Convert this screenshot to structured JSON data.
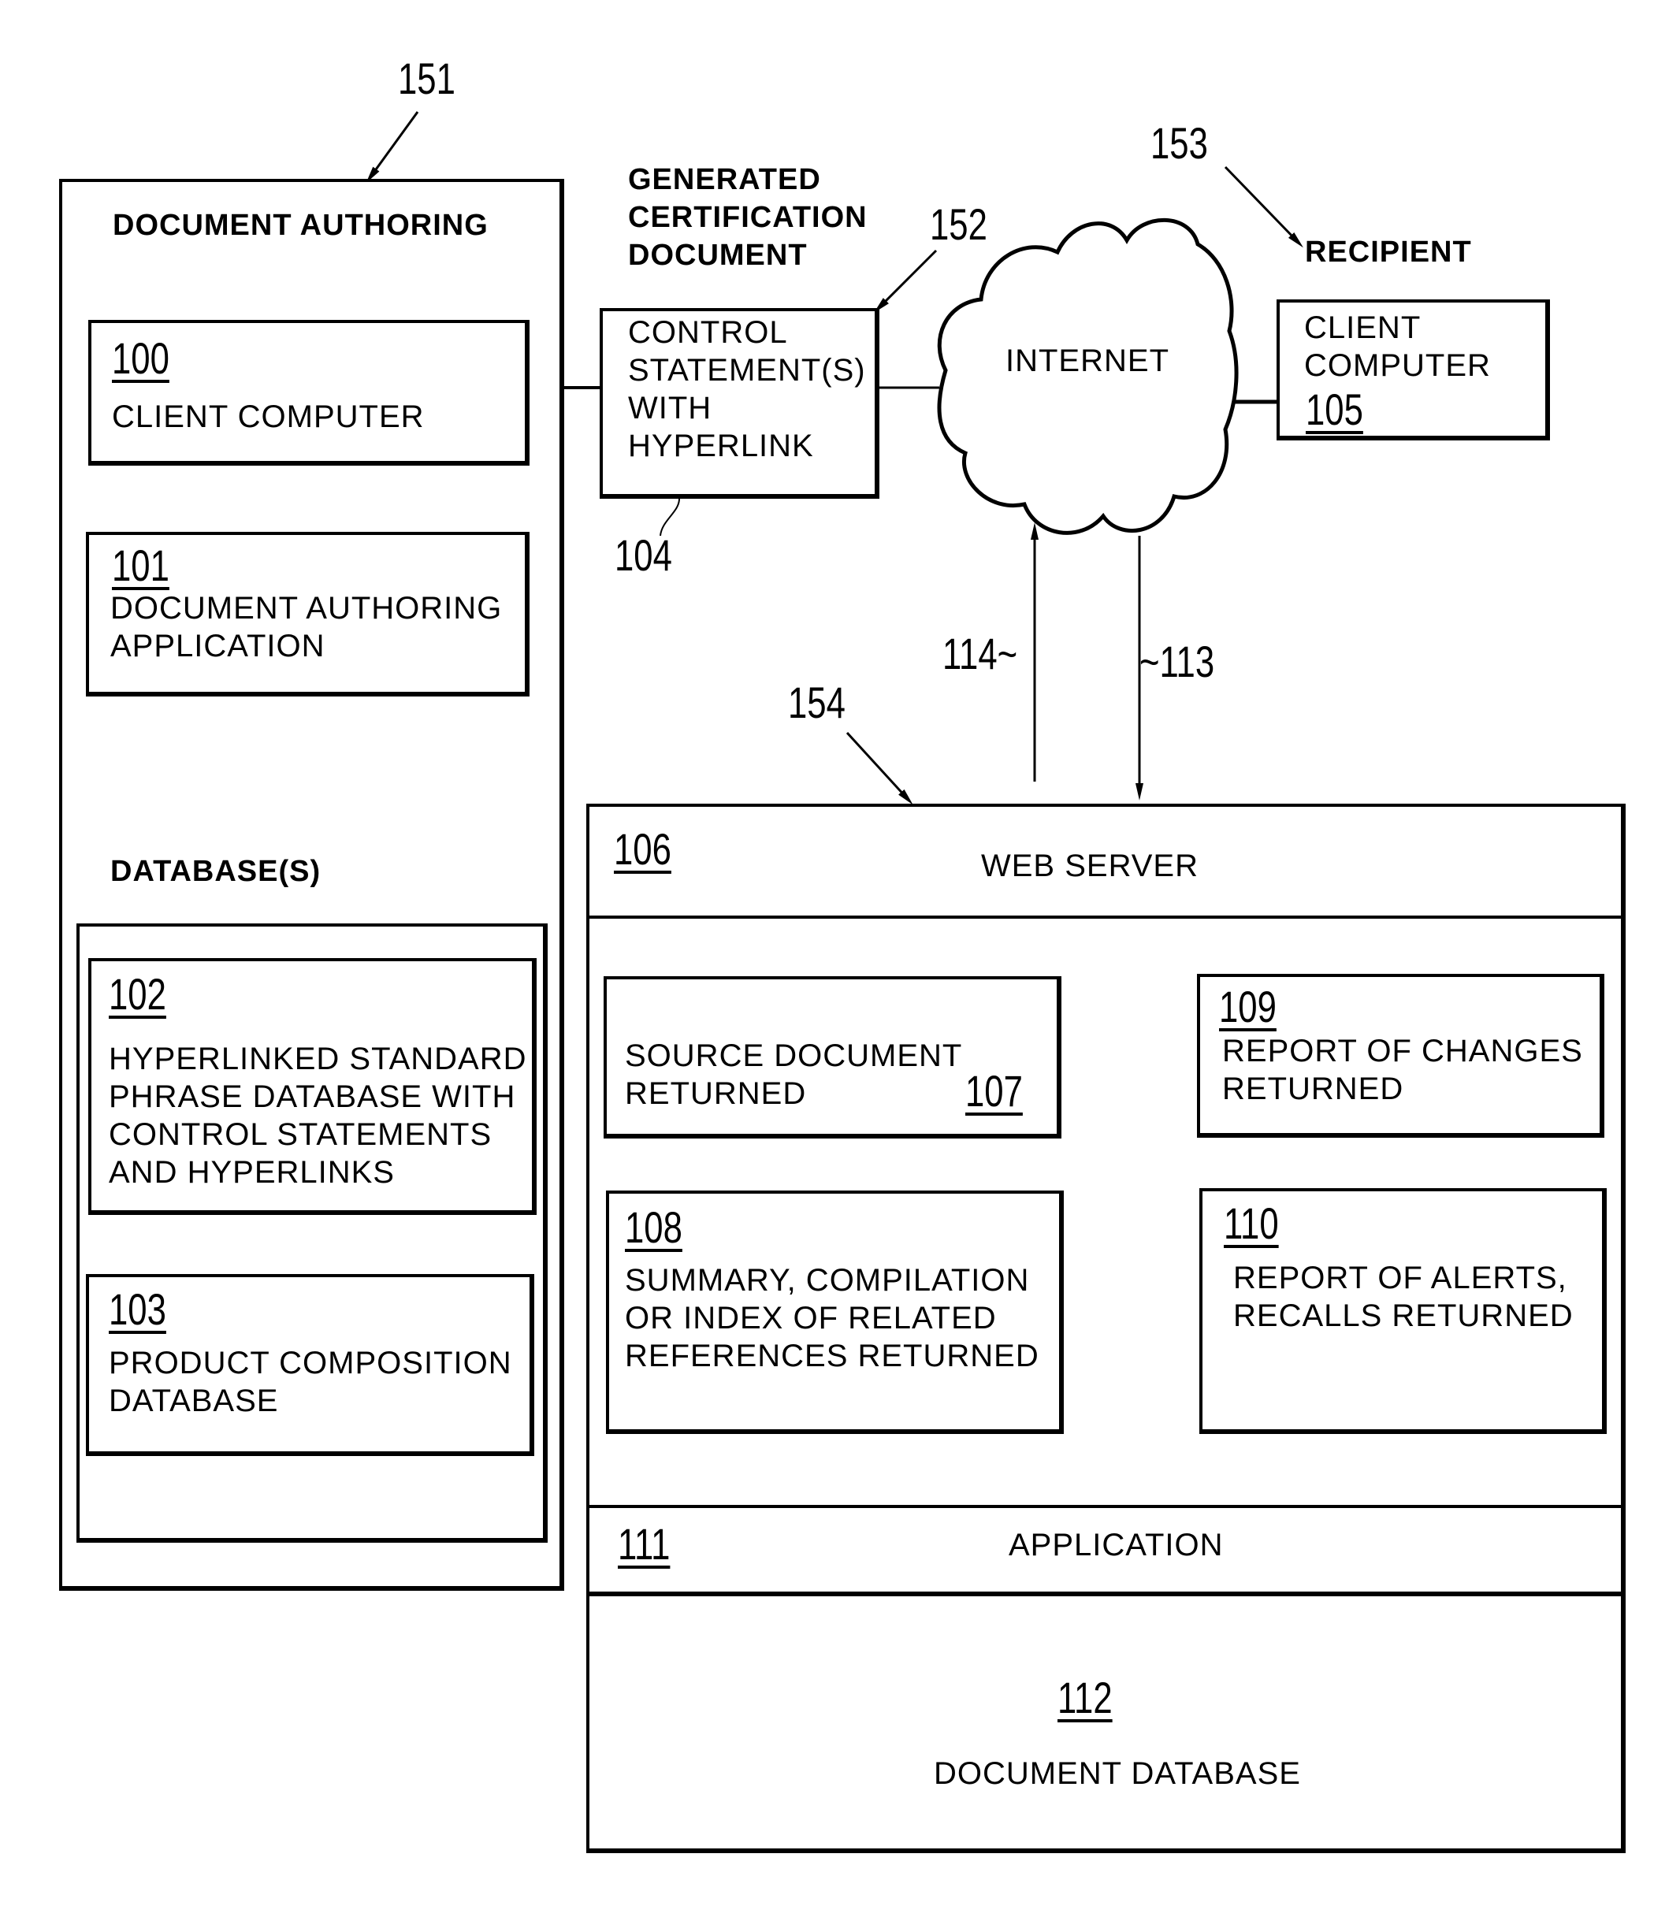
{
  "refs": {
    "r151": "151",
    "r152": "152",
    "r153": "153",
    "r154": "154",
    "r104": "104",
    "r113": "~113",
    "r114": "114~"
  },
  "authoring": {
    "title": "DOCUMENT AUTHORING",
    "client": {
      "num": "100",
      "label": "CLIENT COMPUTER"
    },
    "app": {
      "num": "101",
      "label": "DOCUMENT AUTHORING\nAPPLICATION"
    },
    "databases_label": "DATABASE(S)",
    "db_phrase": {
      "num": "102",
      "label": "HYPERLINKED STANDARD\nPHRASE DATABASE WITH\nCONTROL STATEMENTS\nAND HYPERLINKS"
    },
    "db_product": {
      "num": "103",
      "label": "PRODUCT COMPOSITION\nDATABASE"
    }
  },
  "generated": {
    "title": "GENERATED\nCERTIFICATION\nDOCUMENT",
    "box_label": "CONTROL\nSTATEMENT(S)\n WITH\n HYPERLINK"
  },
  "internet": {
    "label": "INTERNET"
  },
  "recipient": {
    "title": "RECIPIENT",
    "label": "CLIENT\nCOMPUTER",
    "num": "105"
  },
  "server": {
    "web": {
      "num": "106",
      "label": "WEB SERVER"
    },
    "source": {
      "num": "107",
      "label": "SOURCE DOCUMENT\nRETURNED"
    },
    "summary": {
      "num": "108",
      "label": "SUMMARY, COMPILATION\nOR INDEX OF RELATED\nREFERENCES RETURNED"
    },
    "changes": {
      "num": "109",
      "label": "REPORT OF CHANGES\nRETURNED"
    },
    "alerts": {
      "num": "110",
      "label": "REPORT OF ALERTS,\nRECALLS RETURNED"
    },
    "application": {
      "num": "111",
      "label": "APPLICATION"
    },
    "database": {
      "num": "112",
      "label": "DOCUMENT DATABASE"
    }
  }
}
